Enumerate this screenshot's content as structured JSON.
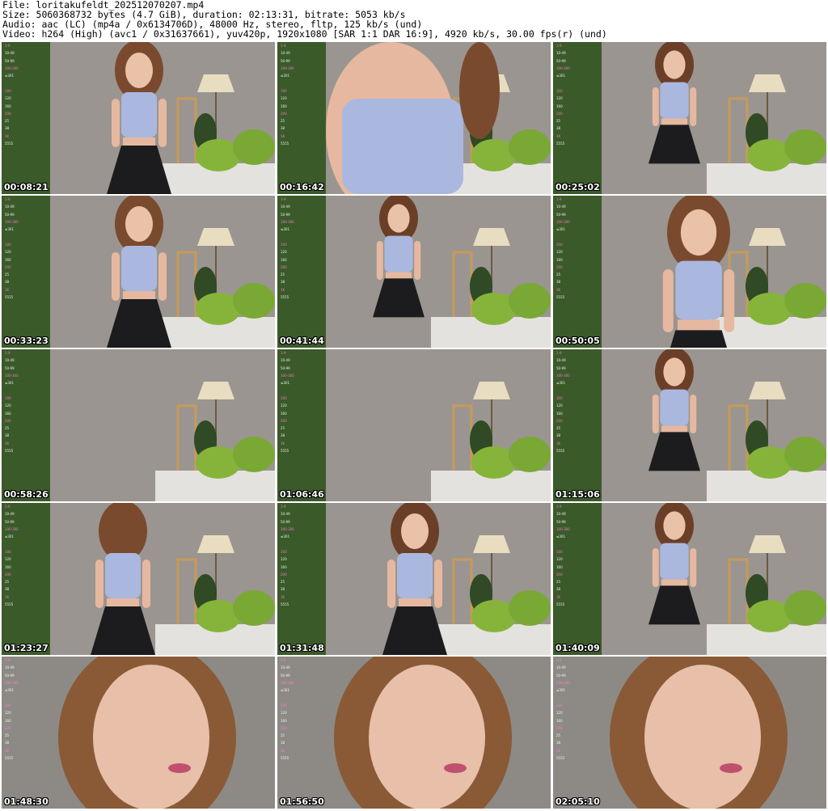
{
  "header": {
    "file": "File: loritakufeldt_202512070207.mp4",
    "size": "Size: 5060368732 bytes (4.7 GiB), duration: 02:13:31, bitrate: 5053 kb/s",
    "audio": "Audio: aac (LC) (mp4a / 0x6134706D), 48000 Hz, stereo, fltp, 125 kb/s (und)",
    "video": "Video: h264 (High) (avc1 / 0x31637661), yuv420p, 1920x1080 [SAR 1:1 DAR 16:9], 4920 kb/s, 30.00 fps(r) (und)"
  },
  "overlay_rows": [
    "1-9",
    "10-49",
    "50-99",
    "100-300",
    "≤301",
    "",
    "100",
    "120",
    "160",
    "200",
    "25",
    "38",
    "1K",
    "5555"
  ],
  "thumbnails": [
    {
      "time": "00:08:21",
      "view": "full",
      "hair": "#7a4a2e",
      "top": "#aab8e0"
    },
    {
      "time": "00:16:42",
      "view": "close-top",
      "hair": "#7a4a2e",
      "top": "#aab8e0"
    },
    {
      "time": "00:25:02",
      "view": "full-small",
      "hair": "#6b3f27",
      "top": "#aab8e0"
    },
    {
      "time": "00:33:23",
      "view": "full",
      "hair": "#7a4a2e",
      "top": "#aab8e0"
    },
    {
      "time": "00:41:44",
      "view": "full-small",
      "hair": "#6b3f27",
      "top": "#aab8e0"
    },
    {
      "time": "00:50:05",
      "view": "close-right",
      "hair": "#7a4a2e",
      "top": "#aab8e0"
    },
    {
      "time": "00:58:26",
      "view": "empty",
      "hair": "#7a4a2e",
      "top": "#aab8e0"
    },
    {
      "time": "01:06:46",
      "view": "empty",
      "hair": "#7a4a2e",
      "top": "#aab8e0"
    },
    {
      "time": "01:15:06",
      "view": "full-small",
      "hair": "#6b3f27",
      "top": "#aab8e0"
    },
    {
      "time": "01:23:27",
      "view": "back",
      "hair": "#7a4a2e",
      "top": "#aab8e0"
    },
    {
      "time": "01:31:48",
      "view": "full",
      "hair": "#6b3f27",
      "top": "#aab8e0"
    },
    {
      "time": "01:40:09",
      "view": "full-small",
      "hair": "#6b3f27",
      "top": "#aab8e0"
    },
    {
      "time": "01:48:30",
      "view": "face",
      "hair": "#8a5a36",
      "top": "#aab8e0"
    },
    {
      "time": "01:56:50",
      "view": "face",
      "hair": "#8a5a36",
      "top": "#aab8e0"
    },
    {
      "time": "02:05:10",
      "view": "face",
      "hair": "#8a5a36",
      "top": "#aab8e0"
    }
  ]
}
